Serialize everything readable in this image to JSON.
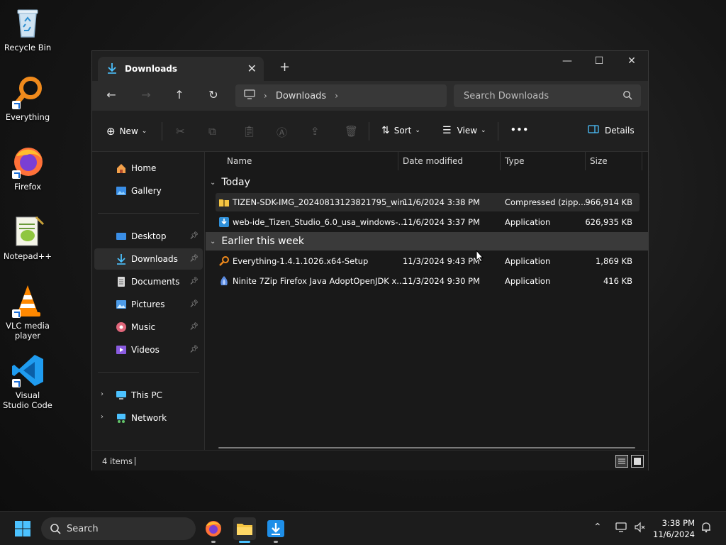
{
  "desktop": {
    "icons": [
      {
        "label": "Recycle Bin"
      },
      {
        "label": "Everything"
      },
      {
        "label": "Firefox"
      },
      {
        "label": "Notepad++"
      },
      {
        "label": "VLC media player"
      },
      {
        "label": "Visual Studio Code"
      }
    ]
  },
  "window": {
    "tab_title": "Downloads",
    "controls": {
      "minimize": "—",
      "maximize": "☐",
      "close": "✕"
    }
  },
  "navbar": {
    "breadcrumb": [
      "Downloads"
    ],
    "search_placeholder": "Search Downloads"
  },
  "toolbar": {
    "new_label": "New",
    "sort_label": "Sort",
    "view_label": "View",
    "more_label": "•••",
    "details_label": "Details"
  },
  "nav_pane": {
    "top_items": [
      {
        "label": "Home"
      },
      {
        "label": "Gallery"
      }
    ],
    "pinned_items": [
      {
        "label": "Desktop"
      },
      {
        "label": "Downloads"
      },
      {
        "label": "Documents"
      },
      {
        "label": "Pictures"
      },
      {
        "label": "Music"
      },
      {
        "label": "Videos"
      }
    ],
    "tree_items": [
      {
        "label": "This PC"
      },
      {
        "label": "Network"
      }
    ],
    "selected": "Downloads"
  },
  "file_list": {
    "columns": [
      "Name",
      "Date modified",
      "Type",
      "Size"
    ],
    "groups": [
      {
        "label": "Today",
        "files": [
          {
            "name": "TIZEN-SDK-IMG_20240813123821795_win...",
            "date": "11/6/2024 3:38 PM",
            "type": "Compressed (zipp...",
            "size": "966,914 KB",
            "icon": "zip-folder-icon"
          },
          {
            "name": "web-ide_Tizen_Studio_6.0_usa_windows-...",
            "date": "11/6/2024 3:37 PM",
            "type": "Application",
            "size": "626,935 KB",
            "icon": "installer-icon"
          }
        ]
      },
      {
        "label": "Earlier this week",
        "files": [
          {
            "name": "Everything-1.4.1.1026.x64-Setup",
            "date": "11/3/2024 9:43 PM",
            "type": "Application",
            "size": "1,869 KB",
            "icon": "everything-app-icon"
          },
          {
            "name": "Ninite 7Zip Firefox Java AdoptOpenJDK x...",
            "date": "11/3/2024 9:30 PM",
            "type": "Application",
            "size": "416 KB",
            "icon": "ninite-app-icon"
          }
        ]
      }
    ]
  },
  "status": {
    "item_count": "4 items"
  },
  "taskbar": {
    "search_label": "Search",
    "time": "3:38 PM",
    "date": "11/6/2024"
  },
  "colors": {
    "accent": "#4cc2ff",
    "window_bg": "#191919",
    "taskbar_bg": "#1c1c1c"
  }
}
